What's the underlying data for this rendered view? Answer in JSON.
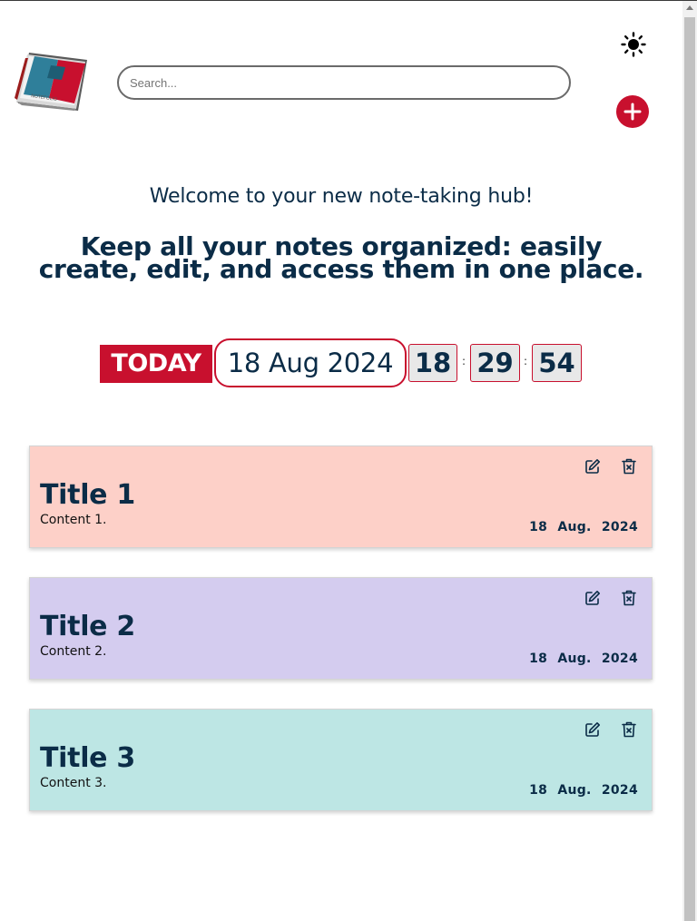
{
  "header": {
    "logo_icon": "notebook-logo",
    "search_placeholder": "Search...",
    "theme_icon": "sun-icon",
    "add_icon": "plus-icon",
    "accent_color": "#c8102e"
  },
  "hero": {
    "welcome": "Welcome to your new note-taking hub!",
    "tagline": "Keep all your notes organized: easily create, edit, and access them in one place."
  },
  "today": {
    "label": "TODAY",
    "date": "18 Aug 2024",
    "hours": "18",
    "minutes": "29",
    "seconds": "54",
    "separator": ":"
  },
  "notes": [
    {
      "title": "Title 1",
      "content": "Content 1.",
      "date": "18 Aug. 2024",
      "color": "#fdd0c8"
    },
    {
      "title": "Title 2",
      "content": "Content 2.",
      "date": "18 Aug. 2024",
      "color": "#d4ccef"
    },
    {
      "title": "Title 3",
      "content": "Content 3.",
      "date": "18 Aug. 2024",
      "color": "#bde6e4"
    }
  ]
}
